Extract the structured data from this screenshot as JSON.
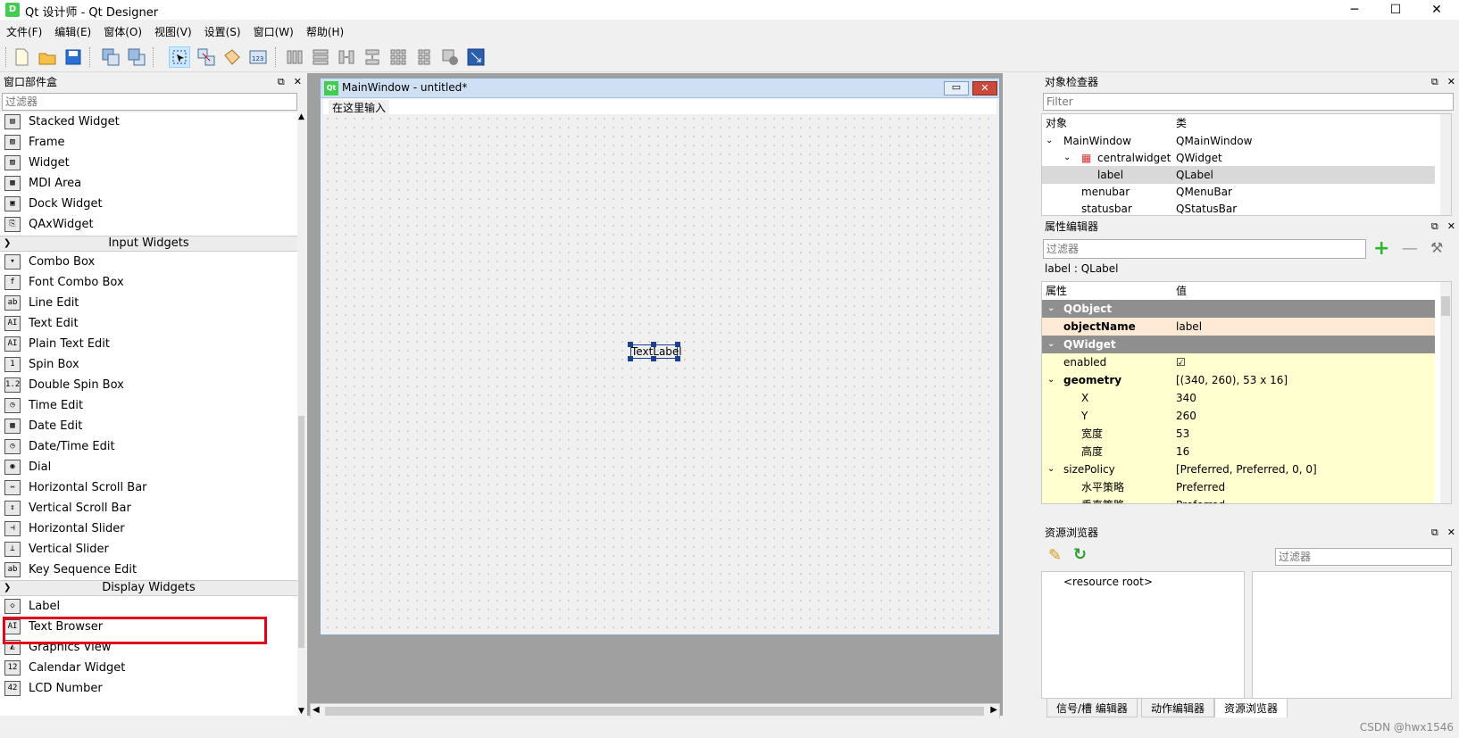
{
  "window": {
    "icon": "D",
    "title": "Qt 设计师 - Qt Designer",
    "min": "─",
    "max": "☐",
    "close": "✕"
  },
  "menu": [
    "文件(F)",
    "编辑(E)",
    "窗体(O)",
    "视图(V)",
    "设置(S)",
    "窗口(W)",
    "帮助(H)"
  ],
  "widget_box": {
    "title": "窗口部件盒",
    "filter_placeholder": "过滤器",
    "items_top": [
      {
        "label": "Stacked Widget",
        "icon": "▤"
      },
      {
        "label": "Frame",
        "icon": "▨"
      },
      {
        "label": "Widget",
        "icon": "▨"
      },
      {
        "label": "MDI Area",
        "icon": "▦"
      },
      {
        "label": "Dock Widget",
        "icon": "▣"
      },
      {
        "label": "QAxWidget",
        "icon": "⎘"
      }
    ],
    "category_input": "Input Widgets",
    "items_input": [
      {
        "label": "Combo Box",
        "icon": "▾"
      },
      {
        "label": "Font Combo Box",
        "icon": "f"
      },
      {
        "label": "Line Edit",
        "icon": "ab"
      },
      {
        "label": "Text Edit",
        "icon": "AI"
      },
      {
        "label": "Plain Text Edit",
        "icon": "AI"
      },
      {
        "label": "Spin Box",
        "icon": "1"
      },
      {
        "label": "Double Spin Box",
        "icon": "1.2"
      },
      {
        "label": "Time Edit",
        "icon": "◷"
      },
      {
        "label": "Date Edit",
        "icon": "▦"
      },
      {
        "label": "Date/Time Edit",
        "icon": "◷"
      },
      {
        "label": "Dial",
        "icon": "◉"
      },
      {
        "label": "Horizontal Scroll Bar",
        "icon": "⇿"
      },
      {
        "label": "Vertical Scroll Bar",
        "icon": "↕"
      },
      {
        "label": "Horizontal Slider",
        "icon": "⊣"
      },
      {
        "label": "Vertical Slider",
        "icon": "⊥"
      },
      {
        "label": "Key Sequence Edit",
        "icon": "ab"
      }
    ],
    "category_display": "Display Widgets",
    "items_display": [
      {
        "label": "Label",
        "icon": "◇"
      },
      {
        "label": "Text Browser",
        "icon": "AI"
      },
      {
        "label": "Graphics View",
        "icon": "◭"
      },
      {
        "label": "Calendar Widget",
        "icon": "12"
      },
      {
        "label": "LCD Number",
        "icon": "42"
      }
    ]
  },
  "form": {
    "title": "MainWindow - untitled*",
    "title_icon": "Qt",
    "menu_placeholder": "在这里输入",
    "label_text": "TextLabel"
  },
  "object_inspector": {
    "title": "对象检查器",
    "filter_placeholder": "Filter",
    "col_object": "对象",
    "col_class": "类",
    "rows": [
      {
        "name": "MainWindow",
        "cls": "QMainWindow"
      },
      {
        "name": "centralwidget",
        "cls": "QWidget"
      },
      {
        "name": "label",
        "cls": "QLabel"
      },
      {
        "name": "menubar",
        "cls": "QMenuBar"
      },
      {
        "name": "statusbar",
        "cls": "QStatusBar"
      }
    ]
  },
  "property_editor": {
    "title": "属性编辑器",
    "filter_placeholder": "过滤器",
    "object_label": "label : QLabel",
    "col_prop": "属性",
    "col_value": "值",
    "rows": [
      {
        "name": "QObject",
        "value": ""
      },
      {
        "name": "objectName",
        "value": "label"
      },
      {
        "name": "QWidget",
        "value": ""
      },
      {
        "name": "enabled",
        "value": "☑"
      },
      {
        "name": "geometry",
        "value": "[(340, 260), 53 x 16]"
      },
      {
        "name": "X",
        "value": "340"
      },
      {
        "name": "Y",
        "value": "260"
      },
      {
        "name": "宽度",
        "value": "53"
      },
      {
        "name": "高度",
        "value": "16"
      },
      {
        "name": "sizePolicy",
        "value": "[Preferred, Preferred, 0, 0]"
      },
      {
        "name": "水平策略",
        "value": "Preferred"
      },
      {
        "name": "垂直策略",
        "value": "Preferred"
      }
    ]
  },
  "resource_browser": {
    "title": "资源浏览器",
    "filter_placeholder": "过滤器",
    "root": "<resource root>"
  },
  "bottom_tabs": [
    "信号/槽 编辑器",
    "动作编辑器",
    "资源浏览器"
  ],
  "watermark": "CSDN @hwx1546"
}
